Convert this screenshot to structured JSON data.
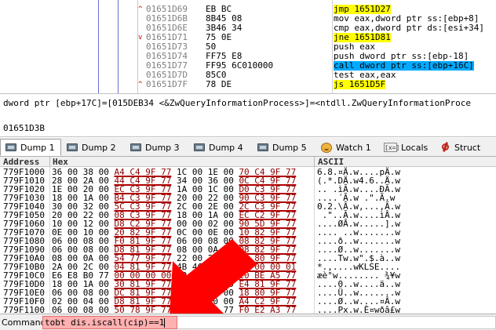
{
  "disasm": [
    {
      "addr": "",
      "bytes": "",
      "instr": "",
      "mark": ""
    },
    {
      "addr": "01651D69",
      "mark": "^",
      "bytes": "EB BC",
      "instr": "jmp 1651D27",
      "style": "jmp"
    },
    {
      "addr": "01651D6B",
      "mark": "",
      "bytes": "8B45 08",
      "instr": "mov eax,dword ptr ss:[ebp+8]",
      "style": "mov"
    },
    {
      "addr": "01651D6E",
      "mark": "",
      "bytes": "3B46 34",
      "instr": "cmp eax,dword ptr ds:[esi+34]",
      "style": "cmp"
    },
    {
      "addr": "01651D71",
      "mark": "v",
      "bytes": "75 0E",
      "instr": "jne 1651D81",
      "style": "jne"
    },
    {
      "addr": "01651D73",
      "mark": "",
      "bytes": "50",
      "instr": "push eax",
      "style": "plain"
    },
    {
      "addr": "01651D74",
      "mark": "",
      "bytes": "FF75 E8",
      "instr": "push dword ptr ss:[ebp-18]",
      "style": "push"
    },
    {
      "addr": "01651D77",
      "mark": "",
      "bytes": "FF95 6C010000",
      "instr": "call dword ptr ss:[ebp+16C]",
      "style": "call"
    },
    {
      "addr": "01651D7D",
      "mark": "",
      "bytes": "85C0",
      "instr": "test eax,eax",
      "style": "plain"
    },
    {
      "addr": "01651D7F",
      "mark": "^",
      "bytes": "78 DE",
      "instr": "js 1651D5F",
      "style": "js"
    }
  ],
  "info": {
    "line1": "dword ptr [ebp+17C]=[015DEB34 <&ZwQueryInformationProcess>]=<ntdll.ZwQueryInformationProce",
    "line2": "01651D3B"
  },
  "tabs": [
    {
      "label": "Dump 1",
      "icon": "dump-icon",
      "active": true
    },
    {
      "label": "Dump 2",
      "icon": "dump-icon"
    },
    {
      "label": "Dump 3",
      "icon": "dump-icon"
    },
    {
      "label": "Dump 4",
      "icon": "dump-icon"
    },
    {
      "label": "Dump 5",
      "icon": "dump-icon"
    },
    {
      "label": "Watch 1",
      "icon": "watch-icon"
    },
    {
      "label": "Locals",
      "icon": "locals-icon",
      "icon_text": "[x=]"
    },
    {
      "label": "Struct",
      "icon": "struct-icon"
    }
  ],
  "dump": {
    "headers": {
      "address": "Address",
      "hex": "Hex",
      "ascii": "ASCII"
    },
    "rows": [
      {
        "addr": "779F1000",
        "hex": "36 00 38 00 A4 C4 9F 77 1C 00 1E 00 70 C4 9F 77",
        "ascii": "6.8.¤Ä.w....pÄ.w"
      },
      {
        "addr": "779F1010",
        "hex": "28 00 2A 00 44 C4 9F 77 34 00 36 00 0C C4 9F 77",
        "ascii": "(.*.DÄ.w4.6..Ä.w"
      },
      {
        "addr": "779F1020",
        "hex": "1E 00 20 00 EC C3 9F 77 1A 00 1C 00 D0 C3 9F 77",
        "ascii": ".. .ìÃ.w....ÐÃ.w"
      },
      {
        "addr": "779F1030",
        "hex": "18 00 1A 00 B4 C3 9F 77 20 00 22 00 90 C3 9F 77",
        "ascii": "....´Ã.w .\".Ã.w"
      },
      {
        "addr": "779F1040",
        "hex": "30 00 32 00 5C C3 9F 77 2C 00 2E 00 2C C3 9F 77",
        "ascii": "0.2.\\Ã.w,...,Ã.w"
      },
      {
        "addr": "779F1050",
        "hex": "20 00 22 00 08 C3 9F 77 18 00 1A 00 EC C2 9F 77",
        "ascii": " .\"..Ã.w....ìÂ.w"
      },
      {
        "addr": "779F1060",
        "hex": "10 00 12 00 D8 C2 9F 77 00 00 02 00 90 5D 9F 77",
        "ascii": "....ØÂ.w.....].w"
      },
      {
        "addr": "779F1070",
        "hex": "0E 00 10 00 20 82 9F 77 0C 00 0E 00 10 82 9F 77",
        "ascii": ".... ..w.......w"
      },
      {
        "addr": "779F1080",
        "hex": "06 00 08 00 F0 81 9F 77 06 00 08 00 08 82 9F 77",
        "ascii": "....ð..w.......w"
      },
      {
        "addr": "779F1090",
        "hex": "06 00 08 00 D8 81 9F 77 08 00 0A 00 08 82 9F 77",
        "ascii": "....Ø..w.......w"
      },
      {
        "addr": "779F10A0",
        "hex": "08 00 0A 00 54 77 9F 77 22 00 24 00 E0 80 9F 77",
        "ascii": "....Tw.w\".$.à..w"
      },
      {
        "addr": "779F10B0",
        "hex": "2A 00 2C 00 04 81 9F 77 4B 4C 53 45 00 00 00 01",
        "ascii": "*.,....wKLSE...."
      },
      {
        "addr": "779F10C0",
        "hex": "E6 E8 B0 77 00 00 00 00 00 00 00 00 20 BE A5 77",
        "ascii": "æè°w........ ¾¥w"
      },
      {
        "addr": "779F10D0",
        "hex": "18 00 1A 00 30 81 9F 77 0A 00 0C 00 E4 81 9F 77",
        "ascii": "....0..w....ä..w"
      },
      {
        "addr": "779F10E0",
        "hex": "06 00 08 00 DC 81 9F 77 06 00 0A 00 18 80 9F 77",
        "ascii": "....Ü..w.......w"
      },
      {
        "addr": "779F10F0",
        "hex": "02 00 04 00 D8 81 9F 77 00 00 00 00 A4 C2 9F 77",
        "ascii": "....Ø..w....¤Â.w"
      },
      {
        "addr": "779F1100",
        "hex": "06 00 08 00 50 78 9F 77 90 C8 A4 77 F0 E2 A3 77",
        "ascii": "....Px.w.È¤wðâ£w"
      }
    ]
  },
  "command": {
    "label": "Command:",
    "value": "tobt dis.iscall(cip)==1"
  },
  "colors": {
    "highlight_yellow": "#ffff00",
    "highlight_blue": "#00aaff",
    "arrow_red": "#ff0000",
    "command_bg": "#ffb0b0"
  }
}
